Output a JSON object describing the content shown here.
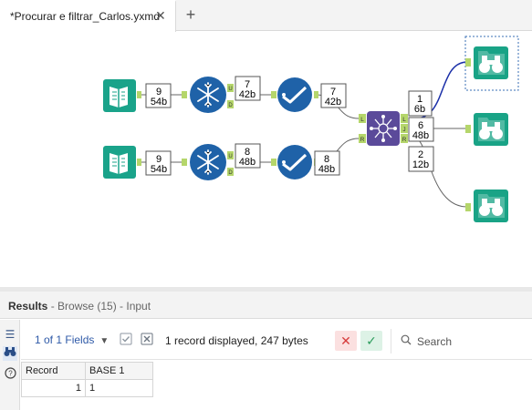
{
  "tab": {
    "title": "*Procurar e filtrar_Carlos.yxmd",
    "close_glyph": "✕",
    "add_glyph": "+"
  },
  "workflow": {
    "top_row": {
      "input_badge": {
        "records": "9",
        "size": "54b"
      },
      "formula_out_u": {
        "records": "7",
        "size": "42b"
      },
      "select_out": {
        "records": "7",
        "size": "42b"
      }
    },
    "bottom_row": {
      "input_badge": {
        "records": "9",
        "size": "54b"
      },
      "formula_out_u": {
        "records": "8",
        "size": "48b"
      },
      "select_out": {
        "records": "8",
        "size": "48b"
      }
    },
    "join": {
      "left_out": {
        "records": "1",
        "size": "6b"
      },
      "join_out": {
        "records": "6",
        "size": "48b"
      },
      "right_out": {
        "records": "2",
        "size": "12b"
      }
    },
    "anchor_letters": {
      "u": "U",
      "d": "D",
      "l": "L",
      "r": "R",
      "j": "J"
    }
  },
  "results": {
    "title": "Results",
    "subtitle": " - Browse (15) - Input",
    "fields_label": "1 of 1 Fields",
    "records_text": "1 record displayed, 247 bytes",
    "search_placeholder": "Search",
    "columns": [
      "Record",
      "BASE 1"
    ],
    "rows": [
      {
        "record": "1",
        "base1": "1"
      }
    ]
  },
  "colors": {
    "input_teal": "#1aa38a",
    "formula_blue": "#1f62a8",
    "select_blue": "#1f62a8",
    "join_purple": "#5b4a9a",
    "browse_teal": "#19a386",
    "anchor_green": "#b5d66b",
    "selected_conn": "#1b2fa8"
  }
}
